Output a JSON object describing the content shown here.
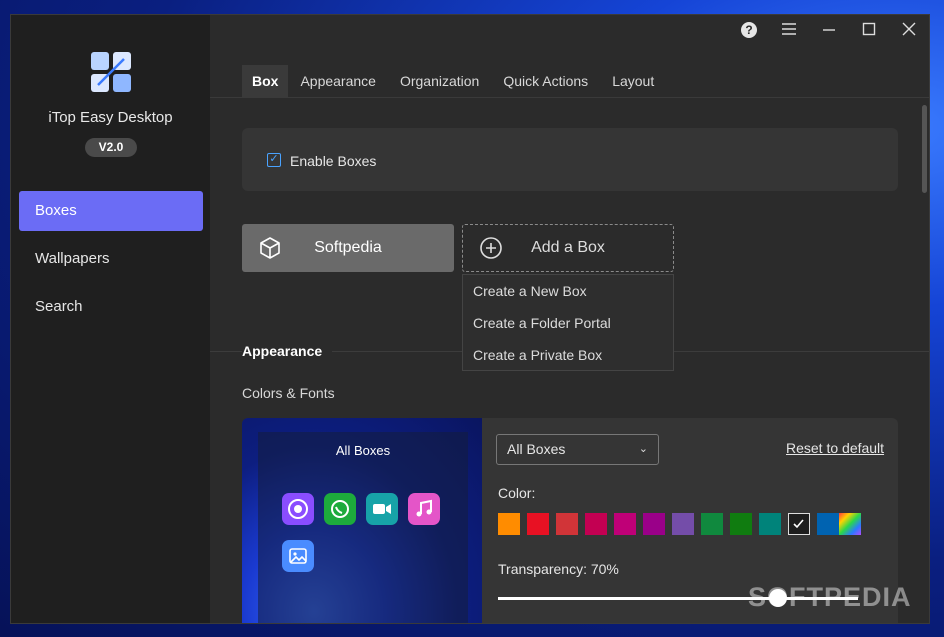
{
  "app": {
    "name": "iTop Easy Desktop",
    "version": "V2.0"
  },
  "sidebar": {
    "items": [
      {
        "label": "Boxes",
        "active": true
      },
      {
        "label": "Wallpapers"
      },
      {
        "label": "Search"
      }
    ]
  },
  "window_controls": {
    "help": "?",
    "menu": "menu-icon",
    "minimize": "minimize-icon",
    "maximize": "maximize-icon",
    "close": "close-icon"
  },
  "tabs": [
    {
      "label": "Box",
      "active": true
    },
    {
      "label": "Appearance"
    },
    {
      "label": "Organization"
    },
    {
      "label": "Quick Actions"
    },
    {
      "label": "Layout"
    }
  ],
  "enable_boxes": {
    "label": "Enable Boxes",
    "checked": true
  },
  "box_list": {
    "existing_box": "Softpedia",
    "add_box": "Add a Box"
  },
  "add_menu": [
    "Create a New Box",
    "Create a Folder Portal",
    "Create a Private Box"
  ],
  "appearance": {
    "title": "Appearance",
    "subtitle": "Colors & Fonts",
    "preview_label": "All Boxes",
    "box_select": "All Boxes",
    "reset": "Reset to default",
    "color_label": "Color:",
    "colors": [
      "#ff8c00",
      "#e81123",
      "#d13438",
      "#c30052",
      "#bf0077",
      "#9a0089",
      "#744da9",
      "#10893e",
      "#107c10",
      "#00837a",
      "#1e1e1e",
      "#0063b1"
    ],
    "selected_color_index": 10,
    "transparency_label": "Transparency: 70%",
    "transparency_value": 70
  },
  "watermark": "SOFTPEDIA"
}
